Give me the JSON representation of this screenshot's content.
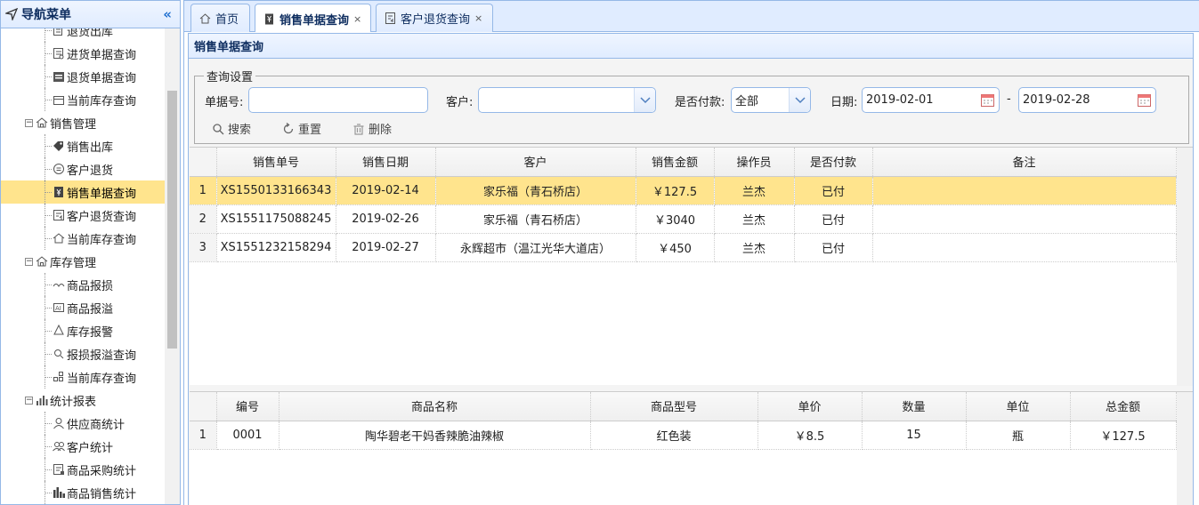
{
  "sidebar": {
    "title": "导航菜单",
    "collapse_icon": "«",
    "items": [
      {
        "kind": "leaf",
        "label": "退货出库",
        "icon": "return-out-icon"
      },
      {
        "kind": "leaf",
        "label": "进货单据查询",
        "icon": "purchase-doc-icon"
      },
      {
        "kind": "leaf",
        "label": "退货单据查询",
        "icon": "return-doc-icon"
      },
      {
        "kind": "leaf",
        "label": "当前库存查询",
        "icon": "stock-icon"
      },
      {
        "kind": "group",
        "label": "销售管理",
        "icon": "home-icon"
      },
      {
        "kind": "leaf",
        "label": "销售出库",
        "icon": "tag-icon"
      },
      {
        "kind": "leaf",
        "label": "客户退货",
        "icon": "customer-return-icon"
      },
      {
        "kind": "leaf",
        "label": "销售单据查询",
        "icon": "sales-doc-icon",
        "selected": true
      },
      {
        "kind": "leaf",
        "label": "客户退货查询",
        "icon": "customer-return-query-icon"
      },
      {
        "kind": "leaf",
        "label": "当前库存查询",
        "icon": "stock-query-icon"
      },
      {
        "kind": "group",
        "label": "库存管理",
        "icon": "home-icon"
      },
      {
        "kind": "leaf",
        "label": "商品报损",
        "icon": "damage-icon"
      },
      {
        "kind": "leaf",
        "label": "商品报溢",
        "icon": "overflow-icon"
      },
      {
        "kind": "leaf",
        "label": "库存报警",
        "icon": "alarm-icon"
      },
      {
        "kind": "leaf",
        "label": "报损报溢查询",
        "icon": "search-icon"
      },
      {
        "kind": "leaf",
        "label": "当前库存查询",
        "icon": "grid-icon"
      },
      {
        "kind": "group",
        "label": "统计报表",
        "icon": "bar-chart-icon"
      },
      {
        "kind": "leaf",
        "label": "供应商统计",
        "icon": "supplier-icon"
      },
      {
        "kind": "leaf",
        "label": "客户统计",
        "icon": "users-icon"
      },
      {
        "kind": "leaf",
        "label": "商品采购统计",
        "icon": "purchase-stat-icon"
      },
      {
        "kind": "leaf",
        "label": "商品销售统计",
        "icon": "sales-stat-icon"
      }
    ]
  },
  "tabs": [
    {
      "label": "首页",
      "icon": "home-icon",
      "closable": false,
      "active": false
    },
    {
      "label": "销售单据查询",
      "icon": "sales-doc-icon",
      "closable": true,
      "active": true
    },
    {
      "label": "客户退货查询",
      "icon": "customer-return-query-icon",
      "closable": true,
      "active": false
    }
  ],
  "panel": {
    "title": "销售单据查询",
    "query": {
      "legend": "查询设置",
      "doc_no_label": "单据号:",
      "doc_no_value": "",
      "customer_label": "客户:",
      "customer_value": "",
      "paid_label": "是否付款:",
      "paid_value": "全部",
      "date_label": "日期:",
      "date_from": "2019-02-01",
      "date_sep": "-",
      "date_to": "2019-02-28",
      "search_label": "搜索",
      "reset_label": "重置",
      "delete_label": "删除"
    }
  },
  "orders": {
    "columns": [
      "销售单号",
      "销售日期",
      "客户",
      "销售金额",
      "操作员",
      "是否付款",
      "备注"
    ],
    "rows": [
      {
        "n": "1",
        "no": "XS1550133166343",
        "date": "2019-02-14",
        "customer": "家乐福（青石桥店）",
        "amount": "￥127.5",
        "operator": "兰杰",
        "paid": "已付",
        "note": ""
      },
      {
        "n": "2",
        "no": "XS1551175088245",
        "date": "2019-02-26",
        "customer": "家乐福（青石桥店）",
        "amount": "￥3040",
        "operator": "兰杰",
        "paid": "已付",
        "note": ""
      },
      {
        "n": "3",
        "no": "XS1551232158294",
        "date": "2019-02-27",
        "customer": "永辉超市（温江光华大道店）",
        "amount": "￥450",
        "operator": "兰杰",
        "paid": "已付",
        "note": ""
      }
    ]
  },
  "items": {
    "columns": [
      "编号",
      "商品名称",
      "商品型号",
      "单价",
      "数量",
      "单位",
      "总金额"
    ],
    "rows": [
      {
        "n": "1",
        "code": "0001",
        "name": "陶华碧老干妈香辣脆油辣椒",
        "model": "红色装",
        "price": "￥8.5",
        "qty": "15",
        "unit": "瓶",
        "total": "￥127.5"
      }
    ]
  },
  "colors": {
    "accent": "#95b8e7",
    "header_bg": "#e0ecff",
    "selected": "#ffe48d"
  }
}
